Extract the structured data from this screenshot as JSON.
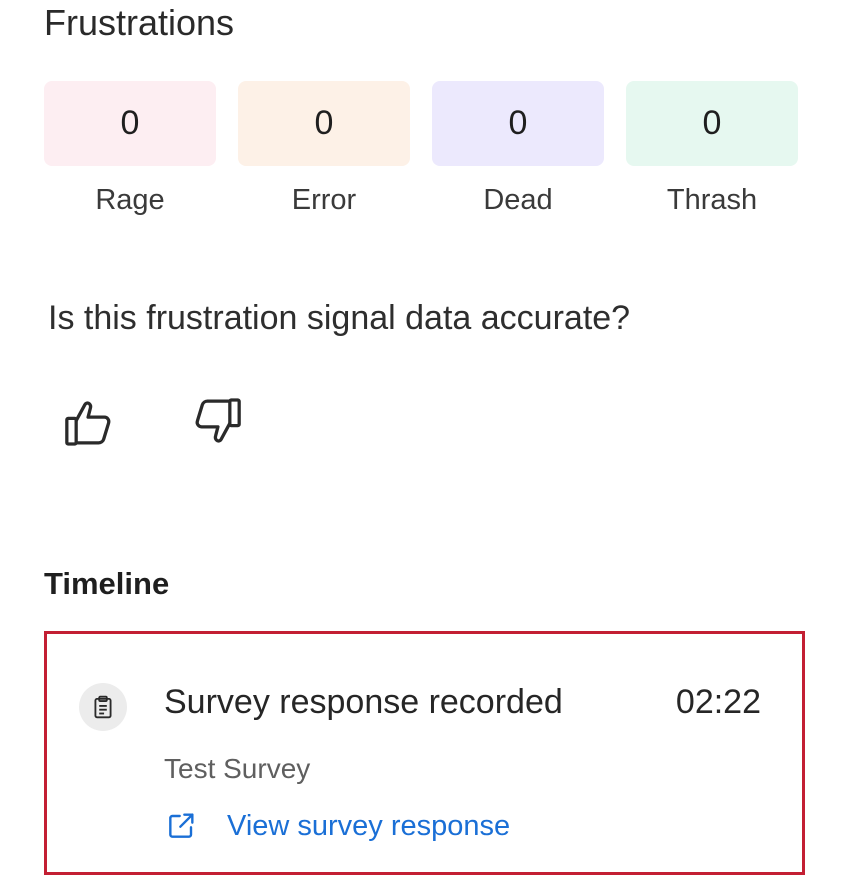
{
  "frustrations": {
    "title": "Frustrations",
    "stats": [
      {
        "value": "0",
        "label": "Rage",
        "color": "#fdeef2"
      },
      {
        "value": "0",
        "label": "Error",
        "color": "#fdf1e7"
      },
      {
        "value": "0",
        "label": "Dead",
        "color": "#ece9fd"
      },
      {
        "value": "0",
        "label": "Thrash",
        "color": "#e6f8f0"
      }
    ],
    "question": "Is this frustration signal data accurate?",
    "feedback_icons": [
      "thumbs-up-icon",
      "thumbs-down-icon"
    ]
  },
  "timeline": {
    "title": "Timeline",
    "highlight_color": "#c31f33",
    "event": {
      "icon": "clipboard-icon",
      "title": "Survey response recorded",
      "time": "02:22",
      "subtitle": "Test Survey",
      "link_icon": "external-link-icon",
      "link_label": "View survey response",
      "link_color": "#1a6fd6"
    }
  }
}
